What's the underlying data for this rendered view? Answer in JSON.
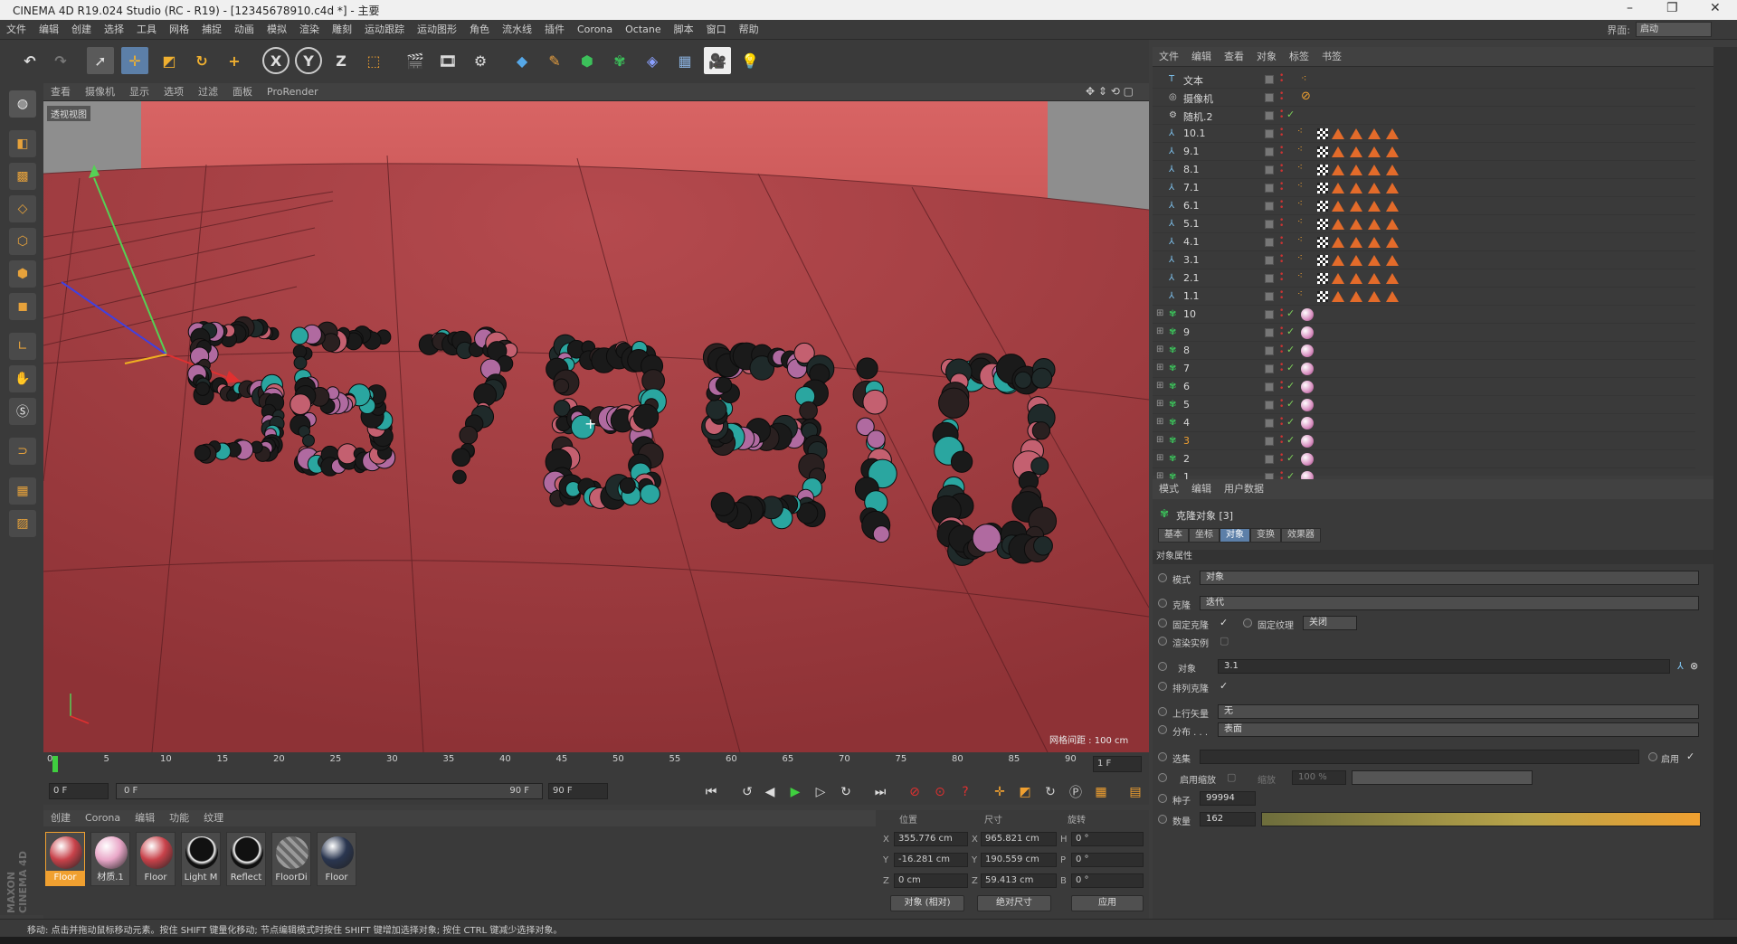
{
  "window": {
    "title": "CINEMA 4D R19.024 Studio (RC - R19) - [12345678910.c4d *] - 主要",
    "minimize": "–",
    "restore": "❐",
    "close": "✕"
  },
  "menubar": {
    "items": [
      "文件",
      "编辑",
      "创建",
      "选择",
      "工具",
      "网格",
      "捕捉",
      "动画",
      "模拟",
      "渲染",
      "雕刻",
      "运动跟踪",
      "运动图形",
      "角色",
      "流水线",
      "插件",
      "Corona",
      "Octane",
      "脚本",
      "窗口",
      "帮助"
    ],
    "layout_label": "界面:",
    "layout_value": "启动"
  },
  "viewport": {
    "menu": [
      "查看",
      "摄像机",
      "显示",
      "选项",
      "过滤",
      "面板",
      "ProRender"
    ],
    "label": "透视视图",
    "grid_info": "网格间距 : 100 cm",
    "digits": [
      "5",
      "6",
      "7",
      "8",
      "9",
      "10"
    ]
  },
  "timeline": {
    "ticks": [
      "0",
      "5",
      "10",
      "15",
      "20",
      "25",
      "30",
      "35",
      "40",
      "45",
      "50",
      "55",
      "60",
      "65",
      "70",
      "75",
      "80",
      "85",
      "90"
    ],
    "end_frame": "1 F"
  },
  "transport": {
    "current": "0 F",
    "range_start": "0 F",
    "range_end": "90 F",
    "max": "90 F"
  },
  "materials": {
    "menu": [
      "创建",
      "Corona",
      "编辑",
      "功能",
      "纹理"
    ],
    "items": [
      {
        "name": "Floor",
        "color": "#c8424a"
      },
      {
        "name": "材质.1",
        "color": "#e9a7c8"
      },
      {
        "name": "Floor",
        "color": "#c8424a"
      },
      {
        "name": "Light M",
        "color": "#111111"
      },
      {
        "name": "Reflect",
        "color": "#111111"
      },
      {
        "name": "FloorDi",
        "color": "#777777"
      },
      {
        "name": "Floor",
        "color": "#2a3650"
      }
    ]
  },
  "coords": {
    "headers": [
      "位置",
      "尺寸",
      "旋转"
    ],
    "x_label": "X",
    "y_label": "Y",
    "z_label": "Z",
    "px": "355.776 cm",
    "py": "-16.281 cm",
    "pz": "0 cm",
    "sx_label": "X",
    "sy_label": "Y",
    "sz_label": "Z",
    "sx": "965.821 cm",
    "sy": "190.559 cm",
    "sz": "59.413 cm",
    "h_label": "H",
    "p_label": "P",
    "b_label": "B",
    "rh": "0 °",
    "rp": "0 °",
    "rb": "0 °",
    "mode": "对象 (相对)",
    "size_mode": "绝对尺寸",
    "apply": "应用"
  },
  "status": "移动: 点击并拖动鼠标移动元素。按住 SHIFT 键量化移动; 节点编辑模式时按住 SHIFT 键增加选择对象; 按住 CTRL 键减少选择对象。",
  "maxon": "MAXON CINEMA 4D",
  "objects": {
    "menu": [
      "文件",
      "编辑",
      "查看",
      "对象",
      "标签",
      "书签"
    ],
    "rows": [
      {
        "name": "文本",
        "type": "text"
      },
      {
        "name": "摄像机",
        "type": "camera"
      },
      {
        "name": "随机.2",
        "type": "effector"
      },
      {
        "name": "10.1",
        "type": "joint"
      },
      {
        "name": "9.1",
        "type": "joint"
      },
      {
        "name": "8.1",
        "type": "joint"
      },
      {
        "name": "7.1",
        "type": "joint"
      },
      {
        "name": "6.1",
        "type": "joint"
      },
      {
        "name": "5.1",
        "type": "joint"
      },
      {
        "name": "4.1",
        "type": "joint"
      },
      {
        "name": "3.1",
        "type": "joint"
      },
      {
        "name": "2.1",
        "type": "joint"
      },
      {
        "name": "1.1",
        "type": "joint"
      },
      {
        "name": "10",
        "type": "cloner"
      },
      {
        "name": "9",
        "type": "cloner"
      },
      {
        "name": "8",
        "type": "cloner"
      },
      {
        "name": "7",
        "type": "cloner"
      },
      {
        "name": "6",
        "type": "cloner"
      },
      {
        "name": "5",
        "type": "cloner"
      },
      {
        "name": "4",
        "type": "cloner"
      },
      {
        "name": "3",
        "type": "cloner",
        "highlight": true
      },
      {
        "name": "2",
        "type": "cloner"
      },
      {
        "name": "1",
        "type": "cloner"
      }
    ]
  },
  "attributes": {
    "menu": [
      "模式",
      "编辑",
      "用户数据"
    ],
    "title": "克隆对象 [3]",
    "tabs": [
      "基本",
      "坐标",
      "对象",
      "变换",
      "效果器"
    ],
    "active_tab": "对象",
    "section": "对象属性",
    "mode_label": "模式",
    "mode_value": "对象",
    "clone_label": "克隆",
    "clone_value": "迭代",
    "fixclone_label": "固定克隆",
    "fixtex_label": "固定纹理",
    "fixtex_value": "关闭",
    "render_instance_label": "渲染实例",
    "object_label": "对象",
    "object_value": "3.1",
    "arrange_label": "排列克隆",
    "upvector_label": "上行矢量",
    "upvector_value": "无",
    "distribute_label": "分布 . . .",
    "distribute_value": "表面",
    "selection_label": "选集",
    "enable_label": "启用",
    "use_scale_label": "启用缩放",
    "scale_label": "缩放",
    "scale_value": "100 %",
    "seed_label": "种子",
    "seed_value": "99994",
    "count_label": "数量",
    "count_value": "162"
  }
}
